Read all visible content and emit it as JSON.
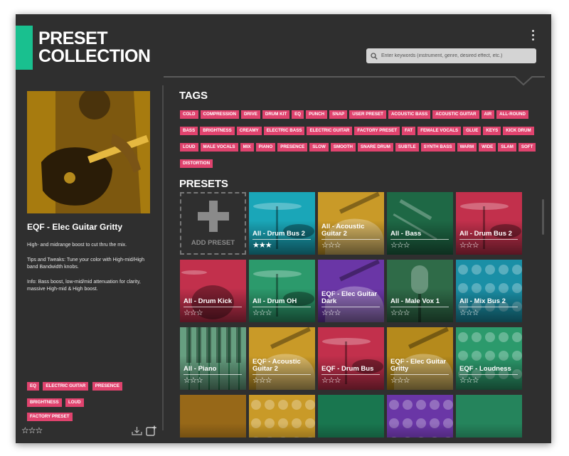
{
  "app": {
    "title": "PRESET\nCOLLECTION",
    "accent_color": "#19c08f",
    "tag_color": "#e0436e",
    "search_placeholder": "Enter keywords (instrument, genre, desired effect, etc.)"
  },
  "detail": {
    "name": "EQF - Elec Guitar Gritty",
    "description": [
      "High- and midrange boost to cut thru the mix.",
      "Tips and Tweaks: Tune your color with High-mid/High band Bandwidth knobs.",
      "Info: Bass boost, low-mid/mid attenuation for clarity, massive High-mid & High boost."
    ],
    "tags": [
      "EQ",
      "ELECTRIC GUITAR",
      "PRESENCE",
      "BRIGHTNESS",
      "LOUD"
    ],
    "factory_tag": "FACTORY PRESET",
    "rating": 0,
    "rating_text": "☆☆☆",
    "icons": [
      "download-icon",
      "add-to-collection-icon"
    ]
  },
  "tags_section": {
    "heading": "TAGS",
    "tags": [
      "COLD",
      "COMPRESSION",
      "DRIVE",
      "DRUM KIT",
      "EQ",
      "PUNCH",
      "SNAP",
      "USER PRESET",
      "ACOUSTIC BASS",
      "ACOUSTIC GUITAR",
      "AIR",
      "ALL-ROUND",
      "BASS",
      "BRIGHTNESS",
      "CREAMY",
      "ELECTRIC BASS",
      "ELECTRIC GUITAR",
      "FACTORY PRESET",
      "FAT",
      "FEMALE VOCALS",
      "GLUE",
      "KEYS",
      "KICK DRUM",
      "LOUD",
      "MALE VOCALS",
      "MIX",
      "PIANO",
      "PRESENCE",
      "SLOW",
      "SMOOTH",
      "SNARE DRUM",
      "SUBTLE",
      "SYNTH BASS",
      "WARM",
      "WIDE",
      "SLAM",
      "SOFT",
      "DISTORTION"
    ]
  },
  "presets_section": {
    "heading": "PRESETS",
    "add_label": "ADD PRESET",
    "presets": [
      {
        "name": "All - Drum Bus 2",
        "stars": "★★★",
        "color": "#1aa6b8",
        "art": "cymbal"
      },
      {
        "name": "All - Acoustic Guitar 2",
        "stars": "☆☆☆",
        "color": "#c99a28",
        "art": "guitar"
      },
      {
        "name": "All - Bass",
        "stars": "☆☆☆",
        "color": "#2ea06a",
        "art": "bass"
      },
      {
        "name": "All - Drum Bus 2",
        "stars": "☆☆☆",
        "color": "#c2304c",
        "art": "cymbal"
      },
      {
        "name": "All - Drum Kick",
        "stars": "☆☆☆",
        "color": "#c2304c",
        "art": "drums"
      },
      {
        "name": "All - Drum OH",
        "stars": "☆☆☆",
        "color": "#2c9a6c",
        "art": "cymbal"
      },
      {
        "name": "EQF - Elec Guitar Dark",
        "stars": "☆☆☆",
        "color": "#6a36a6",
        "art": "guitar"
      },
      {
        "name": "All - Male Vox 1",
        "stars": "☆☆☆",
        "color": "#2f6b48",
        "art": "mic"
      },
      {
        "name": "All - Mix Bus 2",
        "stars": "☆☆☆",
        "color": "#1a8fa6",
        "art": "knobs"
      },
      {
        "name": "All - Piano",
        "stars": "☆☆☆",
        "color": "#2b7a50",
        "art": "piano"
      },
      {
        "name": "EQF - Acoustic Guitar 2",
        "stars": "☆☆☆",
        "color": "#c99a28",
        "art": "guitar"
      },
      {
        "name": "EQF - Drum Bus",
        "stars": "☆☆☆",
        "color": "#c2304c",
        "art": "cymbal"
      },
      {
        "name": "EQF - Elec Guitar Gritty",
        "stars": "☆☆☆",
        "color": "#b58a1c",
        "art": "guitar",
        "selected": true
      },
      {
        "name": "EQF - Loudness",
        "stars": "☆☆☆",
        "color": "#2c9a6c",
        "art": "knobs"
      },
      {
        "name": "",
        "stars": "",
        "color": "#b07a1c",
        "art": "blank"
      },
      {
        "name": "",
        "stars": "",
        "color": "#c99a28",
        "art": "knobs"
      },
      {
        "name": "",
        "stars": "",
        "color": "#1e8a5c",
        "art": "blank"
      },
      {
        "name": "",
        "stars": "",
        "color": "#6a36a6",
        "art": "knobs"
      },
      {
        "name": "",
        "stars": "",
        "color": "#2c9a6c",
        "art": "blank"
      }
    ]
  }
}
